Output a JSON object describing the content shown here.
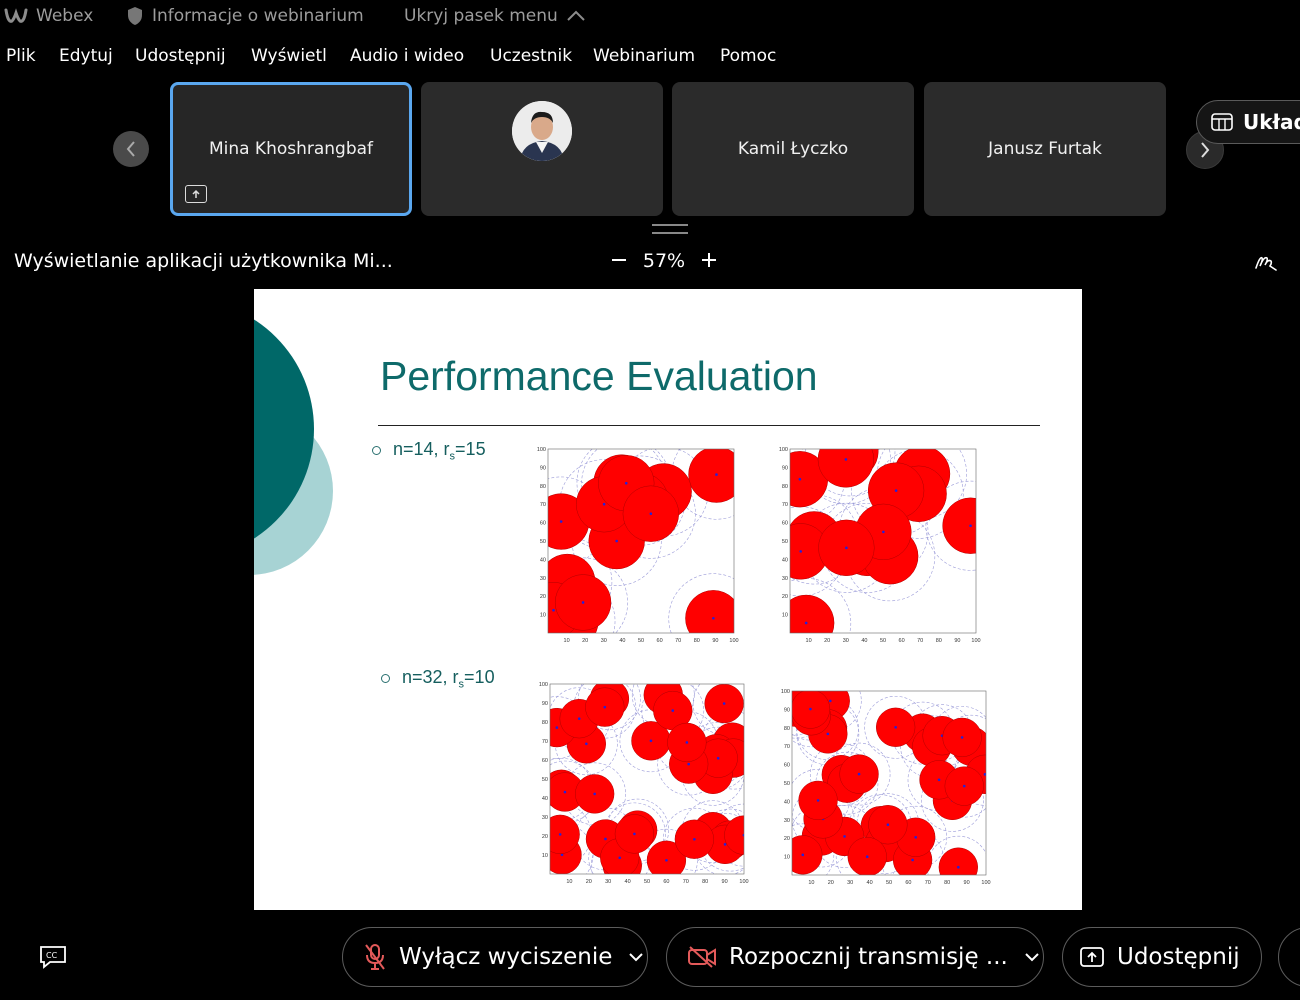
{
  "app": {
    "name": "Webex",
    "info_link": "Informacje o webinarium",
    "hide_menu": "Ukryj pasek menu"
  },
  "menu": [
    {
      "label": "Plik"
    },
    {
      "label": "Edytuj"
    },
    {
      "label": "Udostępnij"
    },
    {
      "label": "Wyświetl"
    },
    {
      "label": "Audio i wideo"
    },
    {
      "label": "Uczestnik"
    },
    {
      "label": "Webinarium"
    },
    {
      "label": "Pomoc"
    }
  ],
  "participants": [
    {
      "name": "Mina Khoshrangbaf",
      "active": true,
      "sharing": true
    },
    {
      "name": "",
      "has_photo": true
    },
    {
      "name": "Kamil Łyczko"
    },
    {
      "name": "Janusz Furtak"
    }
  ],
  "layout_button": "Układ",
  "share_bar": {
    "title": "Wyświetlanie aplikacji użytkownika Mi...",
    "zoom": "57%"
  },
  "slide": {
    "title": "Performance  Evaluation",
    "bullet1": {
      "pre": "n=14, r",
      "sub": "s",
      "post": "=15"
    },
    "bullet2": {
      "pre": "n=32, r",
      "sub": "s",
      "post": "=10"
    },
    "axis_ticks": [
      "10",
      "20",
      "30",
      "40",
      "50",
      "60",
      "70",
      "80",
      "90",
      "100"
    ],
    "colors": {
      "accent": "#0e6a6a",
      "disk": "#ff0000",
      "light_teal": "#a7d3d4"
    }
  },
  "controls": {
    "mute": "Wyłącz wyciszenie",
    "video": "Rozpocznij transmisję ...",
    "share": "Udostępnij"
  }
}
